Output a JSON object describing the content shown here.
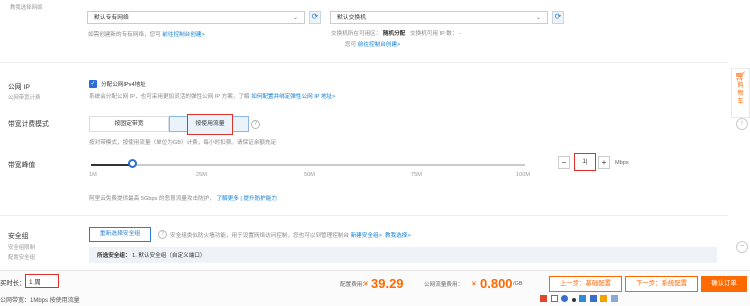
{
  "network": {
    "label": "教我选择网络",
    "vpc_select": "默认专有网络",
    "vswitch_select": "默认交换机",
    "vpc_hint_text": "如需创建新的专有网络，您可",
    "vpc_hint_link": "前往控制台创建>",
    "vswitch_zone_label": "交换机所在可用区：",
    "vswitch_zone_value": "随机分配",
    "vswitch_ip_label": "交换机可用 IP 数：",
    "vswitch_ip_value": "-",
    "vswitch_hint_text": "您可",
    "vswitch_hint_link": "前往控制台创建>"
  },
  "public_ip": {
    "label": "公网 IP",
    "sublabel": "公网带宽计费",
    "checkbox_label": "分配公网IPv4地址",
    "desc": "系统会分配公网 IP，也可采用更加灵活的弹性公网 IP 方案，了解",
    "desc_link": "如何配置并绑定弹性公网 IP 地址>",
    "checked": true
  },
  "billing": {
    "label": "带宽计费模式",
    "option_fixed": "按固定带宽",
    "option_traffic": "按使用流量",
    "help": "?",
    "desc": "按对带模式，按使用流量（单位为GB）计费，每小时扣费。请保证余额充足"
  },
  "bandwidth": {
    "label": "带宽峰值",
    "value": "1",
    "value_display": "1|",
    "unit": "Mbps",
    "minus": "−",
    "plus": "+",
    "ticks": [
      "1M",
      "25M",
      "50M",
      "75M",
      "100M"
    ],
    "level_fraction": 0.32,
    "desc": "阿里云免费提供最高 5Gbps 的恶意流量攻击防护，",
    "desc_link": "了解更多 | 提升防护能力"
  },
  "security": {
    "label": "安全组",
    "sublabel1": "安全组限制",
    "sublabel2": "配置安全组",
    "button": "重新选择安全组",
    "help": "?",
    "desc": "安全组类似防火墙功能，用于设置网络访问控制，您也可以到管理控制台",
    "desc_link1": "新建安全组>",
    "desc_link2": "教我选择>",
    "selected_label": "所选安全组：",
    "selected_value": "1. 默认安全组（自定义端口）"
  },
  "sidebar": {
    "cart_label": "购物车",
    "top_btn": "↑",
    "close_btn": "−"
  },
  "footer": {
    "duration_label": "买时长：",
    "duration_value": "1 周",
    "bandwidth_summary": "公网带宽：1Mbps 按使用流量",
    "config_fee_label": "配置费用：",
    "config_currency": "¥",
    "config_fee": "39.29",
    "traffic_fee_label": "公网流量费用：",
    "traffic_currency": "¥",
    "traffic_fee": "0.800",
    "traffic_unit": "/GB",
    "prev_button": "上一步：基础配置",
    "next_button": "下一步：系统配置",
    "confirm_button": "确认订单",
    "colors": {
      "accent": "#ff6a00",
      "link": "#0f7bd1",
      "highlight": "#e0322a"
    }
  }
}
